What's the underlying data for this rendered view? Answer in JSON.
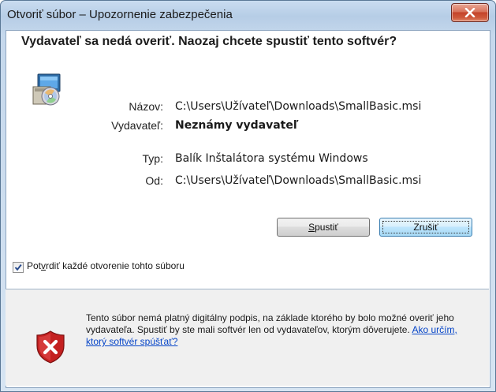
{
  "window": {
    "title": "Otvoriť súbor – Upozornenie zabezpečenia",
    "close_glyph": "✕"
  },
  "heading": "Vydavateľ sa nedá overiť. Naozaj chcete spustiť tento softvér?",
  "details": [
    {
      "label": "Názov:",
      "value": "C:\\Users\\Užívateľ\\Downloads\\SmallBasic.msi",
      "bold": false
    },
    {
      "label": "Vydavateľ:",
      "value": "Neznámy vydavateľ",
      "bold": true
    },
    {
      "label": "Typ:",
      "value": "Balík Inštalátora systému Windows",
      "bold": false
    },
    {
      "label": "Od:",
      "value": "C:\\Users\\Užívateľ\\Downloads\\SmallBasic.msi",
      "bold": false
    }
  ],
  "buttons": {
    "run": {
      "label_access_key": "S",
      "label_rest": "pustiť"
    },
    "cancel": {
      "label": "Zrušiť"
    }
  },
  "checkbox": {
    "checked": true,
    "label_before": "Pot",
    "label_access_key": "v",
    "label_after": "rdiť každé otvorenie tohto súboru"
  },
  "warning": {
    "text": "Tento súbor nemá platný digitálny podpis, na základe ktorého by bolo možné overiť jeho vydavateľa. Spustiť by ste mali softvér len od vydavateľov, ktorým dôverujete. ",
    "link": "Ako určím, ktorý softvér spúšťať?"
  },
  "icons": {
    "package": "installer-package-icon",
    "shield": "security-shield-error-icon",
    "close": "close-icon",
    "checkmark": "checkmark-icon"
  },
  "colors": {
    "link": "#0645c8",
    "close_button": "#c4432a",
    "shield_red": "#d42a2a"
  }
}
